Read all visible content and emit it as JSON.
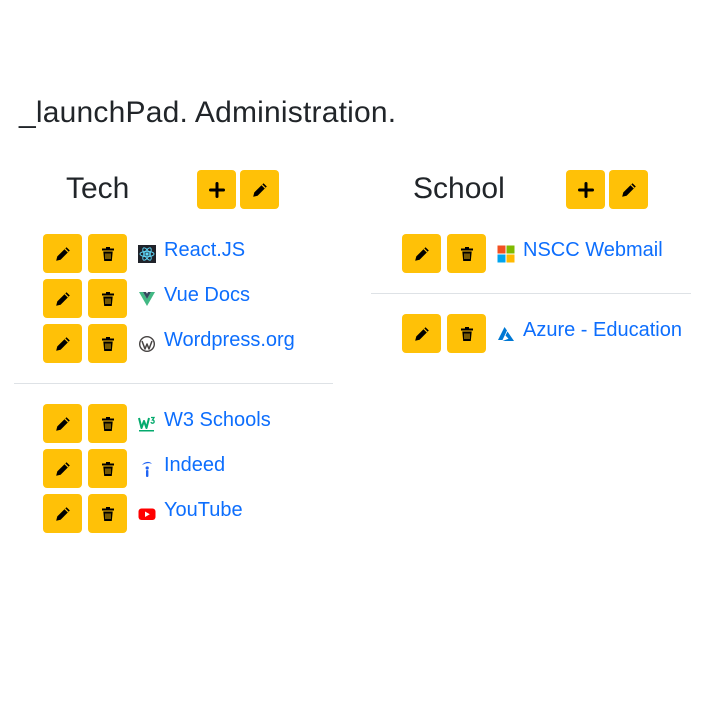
{
  "page": {
    "title": "_launchPad. Administration."
  },
  "categories": [
    {
      "title": "Tech",
      "groups": [
        [
          {
            "label": "React.JS",
            "icon": "react-logo-icon"
          },
          {
            "label": "Vue Docs",
            "icon": "vue-logo-icon"
          },
          {
            "label": "Wordpress.org",
            "icon": "wordpress-logo-icon"
          }
        ],
        [
          {
            "label": "W3 Schools",
            "icon": "w3schools-logo-icon"
          },
          {
            "label": "Indeed",
            "icon": "indeed-logo-icon"
          },
          {
            "label": "YouTube",
            "icon": "youtube-logo-icon"
          }
        ]
      ]
    },
    {
      "title": "School",
      "groups": [
        [
          {
            "label": "NSCC Webmail",
            "icon": "microsoft-logo-icon"
          }
        ],
        [
          {
            "label": "Azure - Education",
            "icon": "azure-logo-icon"
          }
        ]
      ]
    }
  ],
  "colors": {
    "button": "#ffc107",
    "link": "#0d6efd",
    "divider": "#dee2e6",
    "text": "#212529"
  },
  "icons": {
    "add": "plus-icon",
    "edit": "pencil-icon",
    "delete": "trash-icon"
  }
}
